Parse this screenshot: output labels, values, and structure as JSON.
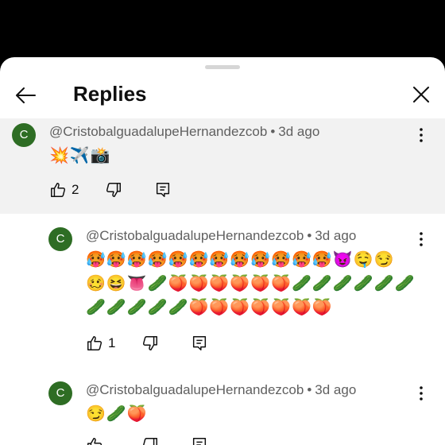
{
  "header": {
    "title": "Replies"
  },
  "parent_comment": {
    "avatar_letter": "C",
    "author": "@CristobalguadalupeHernandezcob",
    "time": "3d ago",
    "text": "💥✈️📸",
    "like_count": "2"
  },
  "replies": [
    {
      "avatar_letter": "C",
      "author": "@CristobalguadalupeHernandezcob",
      "time": "3d ago",
      "text_lines": [
        "🥵🥵🥵🥵🥵🥵🥵🥵🥵🥵🥵🥵😈🤤😏",
        "🥴😆👅🥒🍑🍑🍑🍑🍑🍑🥒🥒🥒🥒🥒🥒",
        "🥒🥒🥒🥒🥒🍑🍑🍑🍑🍑🍑🍑"
      ],
      "like_count": "1"
    },
    {
      "avatar_letter": "C",
      "author": "@CristobalguadalupeHernandezcob",
      "time": "3d ago",
      "text": "😏🥒🍑"
    }
  ],
  "colors": {
    "avatar": "#2e6d24",
    "parent_bg": "#f2f2f2"
  }
}
